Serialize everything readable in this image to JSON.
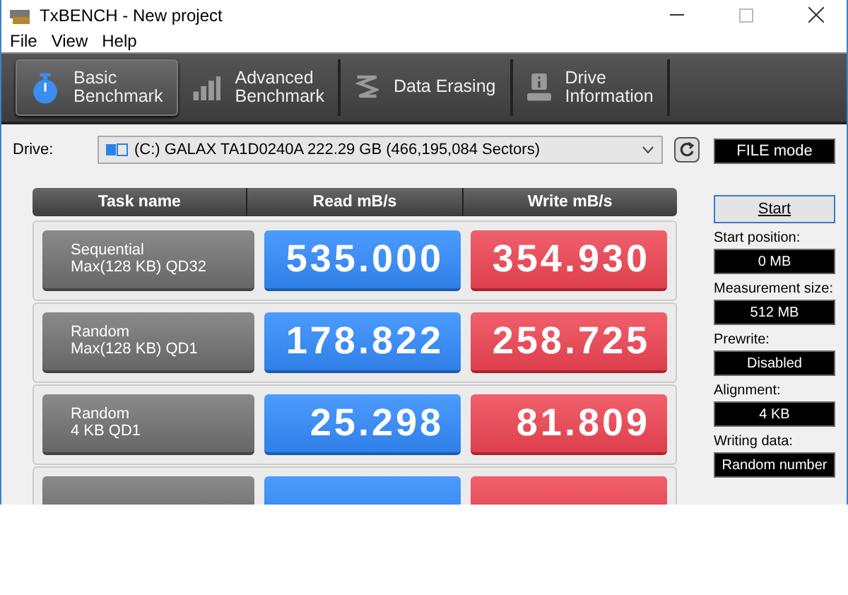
{
  "window": {
    "title": "TxBENCH - New project"
  },
  "menu": [
    "File",
    "View",
    "Help"
  ],
  "tabs": [
    {
      "label": [
        "Basic",
        "Benchmark"
      ],
      "selected": true
    },
    {
      "label": [
        "Advanced",
        "Benchmark"
      ],
      "selected": false
    },
    {
      "label": [
        "Data Erasing"
      ],
      "selected": false
    },
    {
      "label": [
        "Drive",
        "Information"
      ],
      "selected": false
    }
  ],
  "drive": {
    "label": "Drive:",
    "value": "(C:) GALAX TA1D0240A  222.29 GB (466,195,084 Sectors)",
    "mode": "FILE mode"
  },
  "table": {
    "columns": [
      "Task name",
      "Read mB/s",
      "Write mB/s"
    ],
    "rows": [
      {
        "task": [
          "Sequential",
          "Max(128 KB) QD32"
        ],
        "read": "535.000",
        "write": "354.930"
      },
      {
        "task": [
          "Random",
          "Max(128 KB) QD1"
        ],
        "read": "178.822",
        "write": "258.725"
      },
      {
        "task": [
          "Random",
          "4 KB QD1"
        ],
        "read": "25.298",
        "write": "81.809"
      }
    ]
  },
  "start_button": "Start",
  "settings": [
    {
      "label": "Start position:",
      "value": "0 MB"
    },
    {
      "label": "Measurement size:",
      "value": "512 MB"
    },
    {
      "label": "Prewrite:",
      "value": "Disabled"
    },
    {
      "label": "Alignment:",
      "value": "4 KB"
    },
    {
      "label": "Writing data:",
      "value": "Random number"
    }
  ]
}
